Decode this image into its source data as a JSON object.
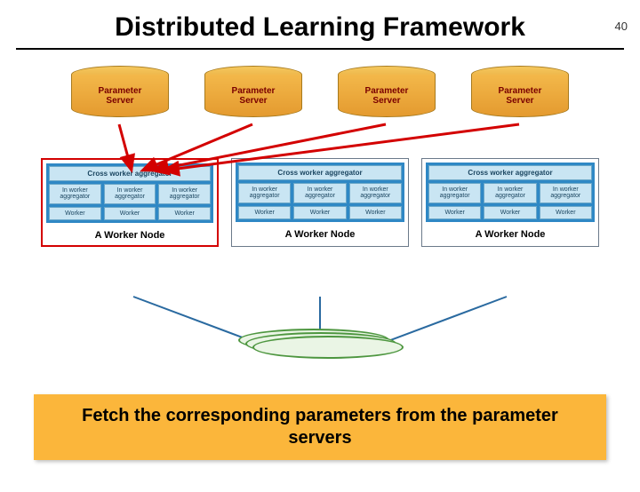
{
  "page_number": "40",
  "title": "Distributed Learning Framework",
  "servers": [
    {
      "line1": "Parameter",
      "line2": "Server"
    },
    {
      "line1": "Parameter",
      "line2": "Server"
    },
    {
      "line1": "Parameter",
      "line2": "Server"
    },
    {
      "line1": "Parameter",
      "line2": "Server"
    }
  ],
  "worker_nodes": [
    {
      "highlighted": true,
      "cross_aggregator": "Cross worker aggregator",
      "in_worker": [
        "In worker aggregator",
        "In worker aggregator",
        "In worker aggregator"
      ],
      "workers": [
        "Worker",
        "Worker",
        "Worker"
      ],
      "label": "A Worker Node"
    },
    {
      "highlighted": false,
      "cross_aggregator": "Cross worker aggregator",
      "in_worker": [
        "In worker aggregator",
        "In worker aggregator",
        "In worker aggregator"
      ],
      "workers": [
        "Worker",
        "Worker",
        "Worker"
      ],
      "label": "A Worker Node"
    },
    {
      "highlighted": false,
      "cross_aggregator": "Cross worker aggregator",
      "in_worker": [
        "In worker aggregator",
        "In worker aggregator",
        "In worker aggregator"
      ],
      "workers": [
        "Worker",
        "Worker",
        "Worker"
      ],
      "label": "A Worker Node"
    }
  ],
  "caption": "Fetch the corresponding parameters from the parameter servers",
  "colors": {
    "server_fill": "#e8a93a",
    "worker_fill": "#2f88c5",
    "arrow_red": "#d30000",
    "arrow_blue": "#2a6aa0",
    "caption_bg": "#fbb63b",
    "data_green": "#4d963f"
  }
}
